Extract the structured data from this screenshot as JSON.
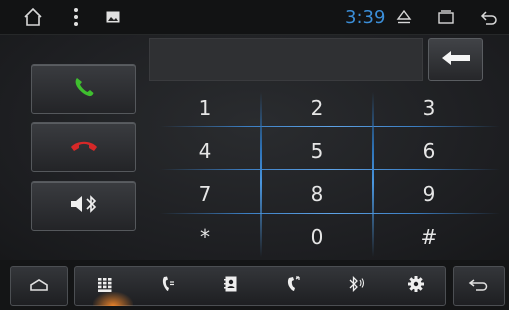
{
  "statusbar": {
    "time": "3:39",
    "icons": [
      "home-icon",
      "more-vert-icon",
      "image-icon",
      "eject-icon",
      "recent-apps-icon",
      "back-icon"
    ]
  },
  "dialer": {
    "number_display": "",
    "keys": [
      "1",
      "2",
      "3",
      "4",
      "5",
      "6",
      "7",
      "8",
      "9",
      "*",
      "0",
      "#"
    ]
  },
  "side_buttons": [
    "call-accept-icon",
    "call-end-icon",
    "bluetooth-audio-icon"
  ],
  "bottombar": {
    "tabs": [
      "dialpad-icon",
      "call-log-icon",
      "contacts-icon",
      "phone-transfer-icon",
      "bluetooth-icon",
      "settings-icon"
    ],
    "active_tab": "dialpad-icon"
  },
  "colors": {
    "accent_blue": "#3b8ed8",
    "accept_green": "#3fbf2f",
    "end_red": "#d62828",
    "active_glow": "#e8822a"
  }
}
